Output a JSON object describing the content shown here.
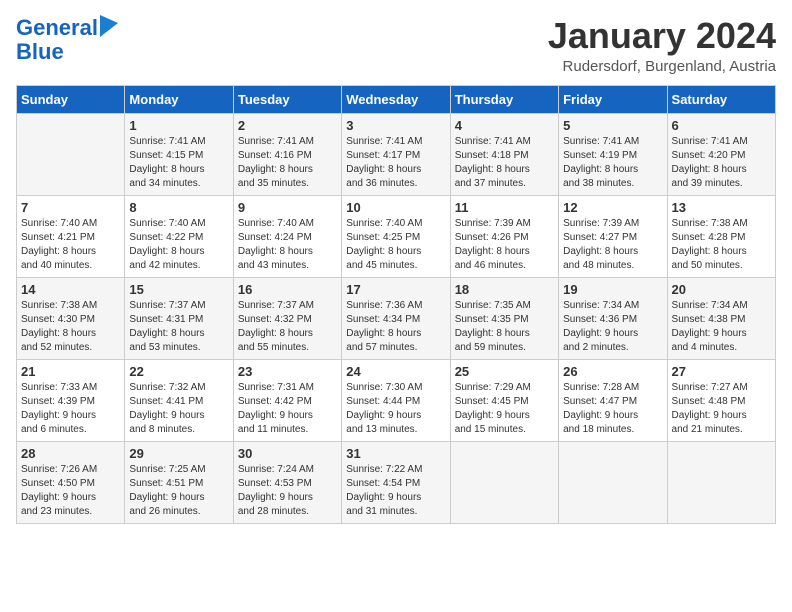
{
  "logo": {
    "line1": "General",
    "line2": "Blue"
  },
  "title": "January 2024",
  "location": "Rudersdorf, Burgenland, Austria",
  "weekdays": [
    "Sunday",
    "Monday",
    "Tuesday",
    "Wednesday",
    "Thursday",
    "Friday",
    "Saturday"
  ],
  "weeks": [
    [
      {
        "day": "",
        "sunrise": "",
        "sunset": "",
        "daylight": ""
      },
      {
        "day": "1",
        "sunrise": "Sunrise: 7:41 AM",
        "sunset": "Sunset: 4:15 PM",
        "daylight": "Daylight: 8 hours and 34 minutes."
      },
      {
        "day": "2",
        "sunrise": "Sunrise: 7:41 AM",
        "sunset": "Sunset: 4:16 PM",
        "daylight": "Daylight: 8 hours and 35 minutes."
      },
      {
        "day": "3",
        "sunrise": "Sunrise: 7:41 AM",
        "sunset": "Sunset: 4:17 PM",
        "daylight": "Daylight: 8 hours and 36 minutes."
      },
      {
        "day": "4",
        "sunrise": "Sunrise: 7:41 AM",
        "sunset": "Sunset: 4:18 PM",
        "daylight": "Daylight: 8 hours and 37 minutes."
      },
      {
        "day": "5",
        "sunrise": "Sunrise: 7:41 AM",
        "sunset": "Sunset: 4:19 PM",
        "daylight": "Daylight: 8 hours and 38 minutes."
      },
      {
        "day": "6",
        "sunrise": "Sunrise: 7:41 AM",
        "sunset": "Sunset: 4:20 PM",
        "daylight": "Daylight: 8 hours and 39 minutes."
      }
    ],
    [
      {
        "day": "7",
        "sunrise": "Sunrise: 7:40 AM",
        "sunset": "Sunset: 4:21 PM",
        "daylight": "Daylight: 8 hours and 40 minutes."
      },
      {
        "day": "8",
        "sunrise": "Sunrise: 7:40 AM",
        "sunset": "Sunset: 4:22 PM",
        "daylight": "Daylight: 8 hours and 42 minutes."
      },
      {
        "day": "9",
        "sunrise": "Sunrise: 7:40 AM",
        "sunset": "Sunset: 4:24 PM",
        "daylight": "Daylight: 8 hours and 43 minutes."
      },
      {
        "day": "10",
        "sunrise": "Sunrise: 7:40 AM",
        "sunset": "Sunset: 4:25 PM",
        "daylight": "Daylight: 8 hours and 45 minutes."
      },
      {
        "day": "11",
        "sunrise": "Sunrise: 7:39 AM",
        "sunset": "Sunset: 4:26 PM",
        "daylight": "Daylight: 8 hours and 46 minutes."
      },
      {
        "day": "12",
        "sunrise": "Sunrise: 7:39 AM",
        "sunset": "Sunset: 4:27 PM",
        "daylight": "Daylight: 8 hours and 48 minutes."
      },
      {
        "day": "13",
        "sunrise": "Sunrise: 7:38 AM",
        "sunset": "Sunset: 4:28 PM",
        "daylight": "Daylight: 8 hours and 50 minutes."
      }
    ],
    [
      {
        "day": "14",
        "sunrise": "Sunrise: 7:38 AM",
        "sunset": "Sunset: 4:30 PM",
        "daylight": "Daylight: 8 hours and 52 minutes."
      },
      {
        "day": "15",
        "sunrise": "Sunrise: 7:37 AM",
        "sunset": "Sunset: 4:31 PM",
        "daylight": "Daylight: 8 hours and 53 minutes."
      },
      {
        "day": "16",
        "sunrise": "Sunrise: 7:37 AM",
        "sunset": "Sunset: 4:32 PM",
        "daylight": "Daylight: 8 hours and 55 minutes."
      },
      {
        "day": "17",
        "sunrise": "Sunrise: 7:36 AM",
        "sunset": "Sunset: 4:34 PM",
        "daylight": "Daylight: 8 hours and 57 minutes."
      },
      {
        "day": "18",
        "sunrise": "Sunrise: 7:35 AM",
        "sunset": "Sunset: 4:35 PM",
        "daylight": "Daylight: 8 hours and 59 minutes."
      },
      {
        "day": "19",
        "sunrise": "Sunrise: 7:34 AM",
        "sunset": "Sunset: 4:36 PM",
        "daylight": "Daylight: 9 hours and 2 minutes."
      },
      {
        "day": "20",
        "sunrise": "Sunrise: 7:34 AM",
        "sunset": "Sunset: 4:38 PM",
        "daylight": "Daylight: 9 hours and 4 minutes."
      }
    ],
    [
      {
        "day": "21",
        "sunrise": "Sunrise: 7:33 AM",
        "sunset": "Sunset: 4:39 PM",
        "daylight": "Daylight: 9 hours and 6 minutes."
      },
      {
        "day": "22",
        "sunrise": "Sunrise: 7:32 AM",
        "sunset": "Sunset: 4:41 PM",
        "daylight": "Daylight: 9 hours and 8 minutes."
      },
      {
        "day": "23",
        "sunrise": "Sunrise: 7:31 AM",
        "sunset": "Sunset: 4:42 PM",
        "daylight": "Daylight: 9 hours and 11 minutes."
      },
      {
        "day": "24",
        "sunrise": "Sunrise: 7:30 AM",
        "sunset": "Sunset: 4:44 PM",
        "daylight": "Daylight: 9 hours and 13 minutes."
      },
      {
        "day": "25",
        "sunrise": "Sunrise: 7:29 AM",
        "sunset": "Sunset: 4:45 PM",
        "daylight": "Daylight: 9 hours and 15 minutes."
      },
      {
        "day": "26",
        "sunrise": "Sunrise: 7:28 AM",
        "sunset": "Sunset: 4:47 PM",
        "daylight": "Daylight: 9 hours and 18 minutes."
      },
      {
        "day": "27",
        "sunrise": "Sunrise: 7:27 AM",
        "sunset": "Sunset: 4:48 PM",
        "daylight": "Daylight: 9 hours and 21 minutes."
      }
    ],
    [
      {
        "day": "28",
        "sunrise": "Sunrise: 7:26 AM",
        "sunset": "Sunset: 4:50 PM",
        "daylight": "Daylight: 9 hours and 23 minutes."
      },
      {
        "day": "29",
        "sunrise": "Sunrise: 7:25 AM",
        "sunset": "Sunset: 4:51 PM",
        "daylight": "Daylight: 9 hours and 26 minutes."
      },
      {
        "day": "30",
        "sunrise": "Sunrise: 7:24 AM",
        "sunset": "Sunset: 4:53 PM",
        "daylight": "Daylight: 9 hours and 28 minutes."
      },
      {
        "day": "31",
        "sunrise": "Sunrise: 7:22 AM",
        "sunset": "Sunset: 4:54 PM",
        "daylight": "Daylight: 9 hours and 31 minutes."
      },
      {
        "day": "",
        "sunrise": "",
        "sunset": "",
        "daylight": ""
      },
      {
        "day": "",
        "sunrise": "",
        "sunset": "",
        "daylight": ""
      },
      {
        "day": "",
        "sunrise": "",
        "sunset": "",
        "daylight": ""
      }
    ]
  ]
}
